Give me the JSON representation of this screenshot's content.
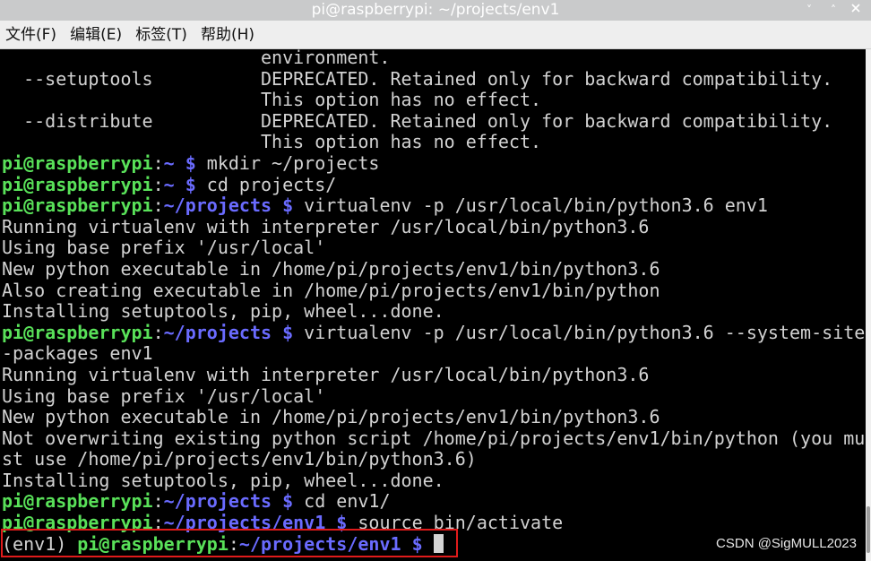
{
  "window": {
    "title": "pi@raspberrypi: ~/projects/env1",
    "minimize_glyph": "˅",
    "maximize_glyph": "˄"
  },
  "menu": [
    "文件(F)",
    "编辑(E)",
    "标签(T)",
    "帮助(H)"
  ],
  "terminal": {
    "lines": [
      [
        {
          "t": "                        environment.",
          "c": "o"
        }
      ],
      [
        {
          "t": "  --setuptools          DEPRECATED. Retained only for backward compatibility.",
          "c": "o"
        }
      ],
      [
        {
          "t": "                        This option has no effect.",
          "c": "o"
        }
      ],
      [
        {
          "t": "  --distribute          DEPRECATED. Retained only for backward compatibility.",
          "c": "o"
        }
      ],
      [
        {
          "t": "                        This option has no effect.",
          "c": "o"
        }
      ],
      [
        {
          "t": "pi@raspberrypi",
          "c": "u"
        },
        {
          "t": ":",
          "c": "o"
        },
        {
          "t": "~ $",
          "c": "p"
        },
        {
          "t": " mkdir ~/projects",
          "c": "o"
        }
      ],
      [
        {
          "t": "pi@raspberrypi",
          "c": "u"
        },
        {
          "t": ":",
          "c": "o"
        },
        {
          "t": "~ $",
          "c": "p"
        },
        {
          "t": " cd projects/",
          "c": "o"
        }
      ],
      [
        {
          "t": "pi@raspberrypi",
          "c": "u"
        },
        {
          "t": ":",
          "c": "o"
        },
        {
          "t": "~/projects $",
          "c": "p"
        },
        {
          "t": " virtualenv -p /usr/local/bin/python3.6 env1",
          "c": "o"
        }
      ],
      [
        {
          "t": "Running virtualenv with interpreter /usr/local/bin/python3.6",
          "c": "o"
        }
      ],
      [
        {
          "t": "Using base prefix '/usr/local'",
          "c": "o"
        }
      ],
      [
        {
          "t": "New python executable in /home/pi/projects/env1/bin/python3.6",
          "c": "o"
        }
      ],
      [
        {
          "t": "Also creating executable in /home/pi/projects/env1/bin/python",
          "c": "o"
        }
      ],
      [
        {
          "t": "Installing setuptools, pip, wheel...done.",
          "c": "o"
        }
      ],
      [
        {
          "t": "pi@raspberrypi",
          "c": "u"
        },
        {
          "t": ":",
          "c": "o"
        },
        {
          "t": "~/projects $",
          "c": "p"
        },
        {
          "t": " virtualenv -p /usr/local/bin/python3.6 --system-site",
          "c": "o"
        }
      ],
      [
        {
          "t": "-packages env1",
          "c": "o"
        }
      ],
      [
        {
          "t": "Running virtualenv with interpreter /usr/local/bin/python3.6",
          "c": "o"
        }
      ],
      [
        {
          "t": "Using base prefix '/usr/local'",
          "c": "o"
        }
      ],
      [
        {
          "t": "New python executable in /home/pi/projects/env1/bin/python3.6",
          "c": "o"
        }
      ],
      [
        {
          "t": "Not overwriting existing python script /home/pi/projects/env1/bin/python (you mu",
          "c": "o"
        }
      ],
      [
        {
          "t": "st use /home/pi/projects/env1/bin/python3.6)",
          "c": "o"
        }
      ],
      [
        {
          "t": "Installing setuptools, pip, wheel...done.",
          "c": "o"
        }
      ],
      [
        {
          "t": "pi@raspberrypi",
          "c": "u"
        },
        {
          "t": ":",
          "c": "o"
        },
        {
          "t": "~/projects $",
          "c": "p"
        },
        {
          "t": " cd env1/",
          "c": "o"
        }
      ],
      [
        {
          "t": "pi@raspberrypi",
          "c": "u"
        },
        {
          "t": ":",
          "c": "o"
        },
        {
          "t": "~/projects/env1 $",
          "c": "p"
        },
        {
          "t": " source bin/activate",
          "c": "o"
        }
      ],
      [
        {
          "t": "(env1) ",
          "c": "o"
        },
        {
          "t": "pi@raspberrypi",
          "c": "u"
        },
        {
          "t": ":",
          "c": "o"
        },
        {
          "t": "~/projects/env1 $",
          "c": "p"
        },
        {
          "t": " ",
          "c": "o"
        }
      ]
    ]
  },
  "watermark": "CSDN @SigMULL2023",
  "colors": {
    "user_host": "#59e159",
    "path_prompt": "#6a6bff",
    "output_text": "#d2d2d2",
    "highlight_box": "#e01b1b"
  }
}
